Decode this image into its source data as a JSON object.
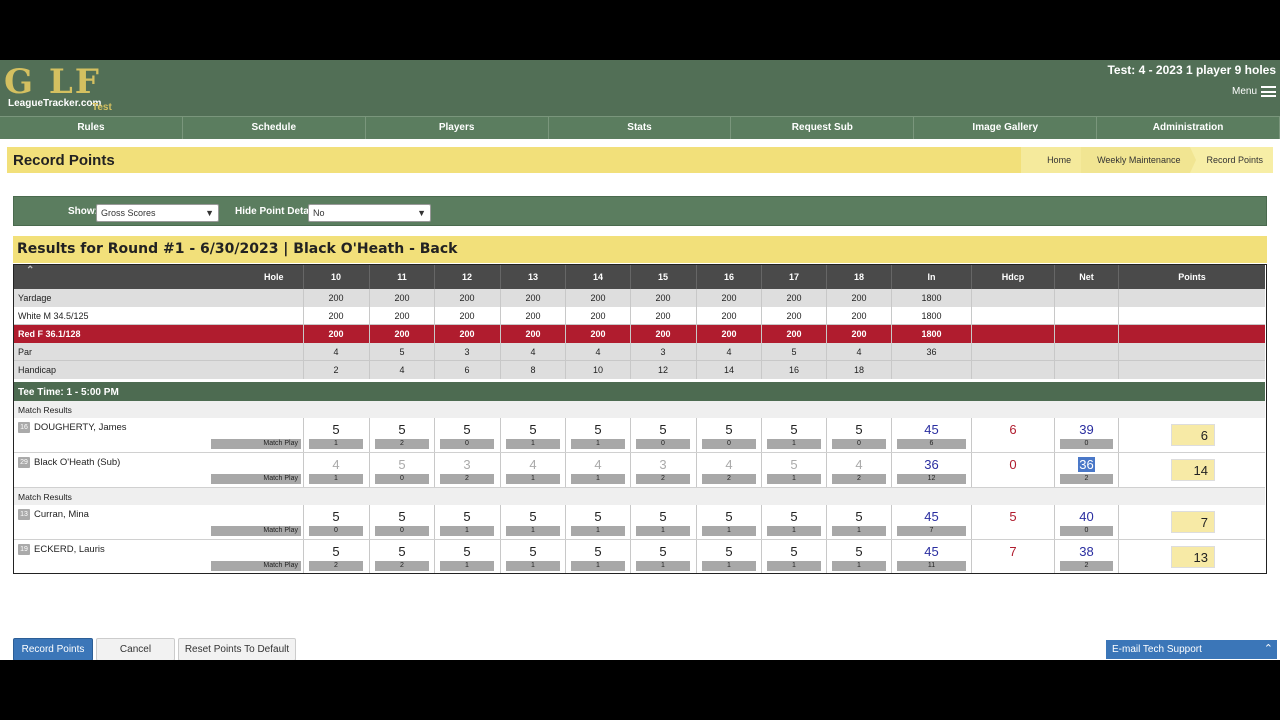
{
  "header": {
    "logo_text": "G  LF",
    "logo_subtext": "LeagueTracker.com",
    "logo_test": "Test",
    "league_title": "Test: 4 - 2023 1 player 9 holes",
    "menu_label": "Menu"
  },
  "nav": {
    "items": [
      "Rules",
      "Schedule",
      "Players",
      "Stats",
      "Request Sub",
      "Image Gallery",
      "Administration"
    ]
  },
  "page": {
    "title": "Record Points",
    "breadcrumb": [
      "Home",
      "Weekly Maintenance",
      "Record Points"
    ]
  },
  "filters": {
    "show_label": "Show:",
    "show_value": "Gross Scores",
    "hide_label": "Hide Point Detail:",
    "hide_value": "No"
  },
  "results": {
    "title": "Results for Round #1 - 6/30/2023 | Black O'Heath - Back"
  },
  "table": {
    "hole_label": "Hole",
    "holes": [
      "10",
      "11",
      "12",
      "13",
      "14",
      "15",
      "16",
      "17",
      "18"
    ],
    "in_label": "In",
    "hdcp_label": "Hdcp",
    "net_label": "Net",
    "points_label": "Points",
    "info_rows": [
      {
        "label": "Yardage",
        "values": [
          "200",
          "200",
          "200",
          "200",
          "200",
          "200",
          "200",
          "200",
          "200"
        ],
        "in": "1800"
      },
      {
        "label": "White M 34.5/125",
        "values": [
          "200",
          "200",
          "200",
          "200",
          "200",
          "200",
          "200",
          "200",
          "200"
        ],
        "in": "1800"
      },
      {
        "label": "Red F 36.1/128",
        "values": [
          "200",
          "200",
          "200",
          "200",
          "200",
          "200",
          "200",
          "200",
          "200"
        ],
        "in": "1800"
      },
      {
        "label": "Par",
        "values": [
          "4",
          "5",
          "3",
          "4",
          "4",
          "3",
          "4",
          "5",
          "4"
        ],
        "in": "36"
      },
      {
        "label": "Handicap",
        "values": [
          "2",
          "4",
          "6",
          "8",
          "10",
          "12",
          "14",
          "16",
          "18"
        ],
        "in": ""
      }
    ],
    "tee_time": "Tee Time: 1 - 5:00 PM",
    "match_results_label": "Match Results",
    "match_play_label": "Match Play",
    "players": [
      {
        "num": "16",
        "name": "DOUGHERTY, James",
        "scores": [
          "5",
          "5",
          "5",
          "5",
          "5",
          "5",
          "5",
          "5",
          "5"
        ],
        "pts": [
          "1",
          "2",
          "0",
          "1",
          "1",
          "0",
          "0",
          "1",
          "0"
        ],
        "in": "45",
        "in_pts": "6",
        "hdcp": "6",
        "net": "39",
        "net_pts": "0",
        "points": "6"
      },
      {
        "num": "29",
        "name": "Black O'Heath (Sub)",
        "scores": [
          "4",
          "5",
          "3",
          "4",
          "4",
          "3",
          "4",
          "5",
          "4"
        ],
        "pts": [
          "1",
          "0",
          "2",
          "1",
          "1",
          "2",
          "2",
          "1",
          "2"
        ],
        "in": "36",
        "in_pts": "12",
        "hdcp": "0",
        "net": "36",
        "net_pts": "2",
        "points": "14"
      },
      {
        "num": "13",
        "name": "Curran, Mina",
        "scores": [
          "5",
          "5",
          "5",
          "5",
          "5",
          "5",
          "5",
          "5",
          "5"
        ],
        "pts": [
          "0",
          "0",
          "1",
          "1",
          "1",
          "1",
          "1",
          "1",
          "1"
        ],
        "in": "45",
        "in_pts": "7",
        "hdcp": "5",
        "net": "40",
        "net_pts": "0",
        "points": "7"
      },
      {
        "num": "19",
        "name": "ECKERD, Lauris",
        "scores": [
          "5",
          "5",
          "5",
          "5",
          "5",
          "5",
          "5",
          "5",
          "5"
        ],
        "pts": [
          "2",
          "2",
          "1",
          "1",
          "1",
          "1",
          "1",
          "1",
          "1"
        ],
        "in": "45",
        "in_pts": "11",
        "hdcp": "7",
        "net": "38",
        "net_pts": "2",
        "points": "13"
      }
    ]
  },
  "buttons": {
    "record": "Record Points",
    "cancel": "Cancel",
    "reset": "Reset Points To Default"
  },
  "support": {
    "label": "E-mail Tech Support"
  },
  "colors": {
    "header_green": "#526f56",
    "yellow": "#f2e07a",
    "red_tee": "#b01c2e",
    "accent_blue": "#3b76b8"
  }
}
